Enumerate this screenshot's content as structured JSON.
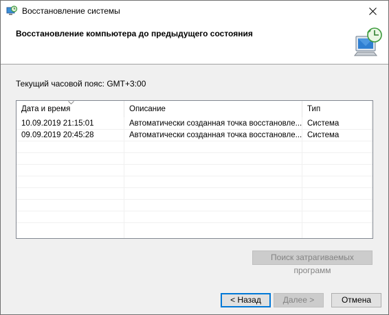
{
  "window": {
    "title": "Восстановление системы"
  },
  "header": {
    "title": "Восстановление компьютера до предыдущего состояния"
  },
  "timezone_label": "Текущий часовой пояс: GMT+3:00",
  "table": {
    "columns": [
      "Дата и время",
      "Описание",
      "Тип"
    ],
    "sorted_column": "Дата и время",
    "rows": [
      [
        "10.09.2019 21:15:01",
        "Автоматически созданная точка восстановле...",
        "Система"
      ],
      [
        "09.09.2019 20:45:28",
        "Автоматически созданная точка восстановле...",
        "Система"
      ]
    ]
  },
  "buttons": {
    "affected": "Поиск затрагиваемых программ",
    "back": "< Назад",
    "next": "Далее >",
    "cancel": "Отмена"
  },
  "icons": {
    "title": "system-restore-icon",
    "header": "restore-computer-icon",
    "close": "close-icon"
  },
  "colors": {
    "accent": "#0078d7",
    "disabled_text": "#838383"
  }
}
